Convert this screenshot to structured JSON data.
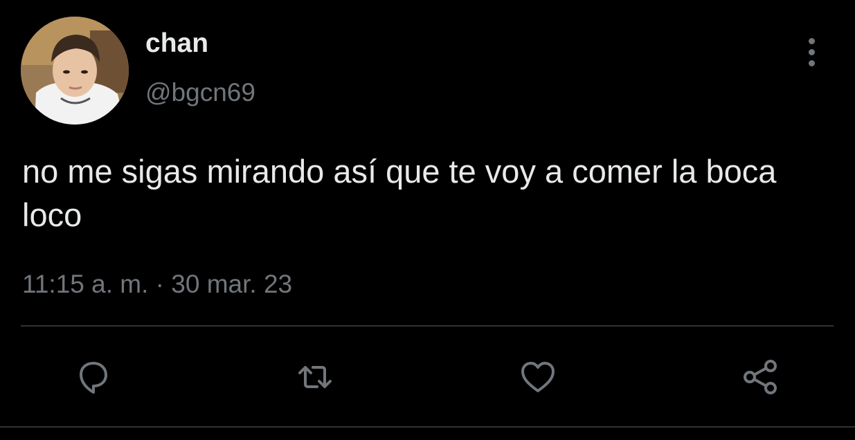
{
  "user": {
    "display_name": "chan",
    "handle": "@bgcn69"
  },
  "tweet": {
    "text": "no me sigas mirando así que te voy a comer la boca loco",
    "time": "11:15 a. m.",
    "separator": " · ",
    "date": "30 mar. 23"
  },
  "actions": {
    "reply_icon": "comment-icon",
    "retweet_icon": "retweet-icon",
    "like_icon": "heart-icon",
    "share_icon": "share-icon"
  },
  "colors": {
    "background": "#000000",
    "primary_text": "#e7e9ea",
    "secondary_text": "#71767b",
    "divider": "#2f3336"
  }
}
